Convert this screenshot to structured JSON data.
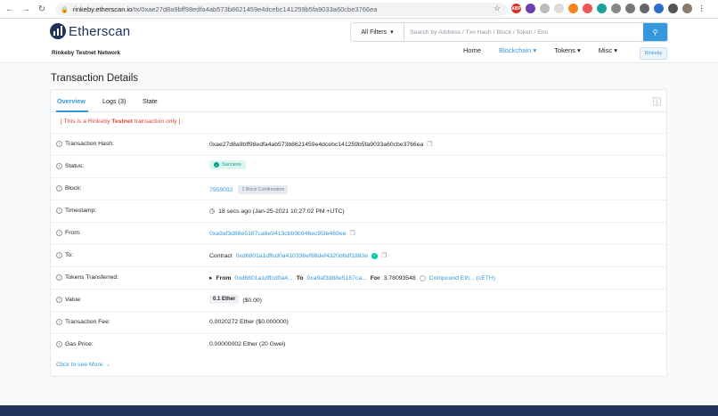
{
  "browser": {
    "url_host": "rinkeby.etherscan.io",
    "url_path": "/tx/0xae27d8a9bff98edfa4ab573b8621459e4dcebc141259b5fa9033a60cbe3766ea"
  },
  "header": {
    "logo_text": "Etherscan",
    "network_label": "Rinkeby Testnet Network",
    "search": {
      "filter_label": "All Filters",
      "placeholder": "Search by Address / Txn Hash / Block / Token / Ens"
    },
    "nav": [
      {
        "label": "Home"
      },
      {
        "label": "Blockchain"
      },
      {
        "label": "Tokens"
      },
      {
        "label": "Misc"
      }
    ],
    "network_badge": "Rinkeby"
  },
  "page_title": "Transaction Details",
  "tabs": [
    {
      "label": "Overview"
    },
    {
      "label": "Logs (3)"
    },
    {
      "label": "State"
    }
  ],
  "notice": {
    "prefix": "[ This is a Rinkeby ",
    "bold": "Testnet",
    "suffix": " transaction only ]"
  },
  "fields": {
    "hash": {
      "label": "Transaction Hash:",
      "value": "0xae27d8a9bff98edfa4ab573b8621459e4dcebc141259b5fa9033a60cbe3766ea"
    },
    "status": {
      "label": "Status:",
      "value": "Success"
    },
    "block": {
      "label": "Block:",
      "value": "7959032",
      "confirmation": "1 Block Confirmation"
    },
    "timestamp": {
      "label": "Timestamp:",
      "value": "18 secs ago (Jan-25-2021 10:27:02 PM +UTC)"
    },
    "from": {
      "label": "From:",
      "value": "0xa9af3d88e5167ca6e9413cbb9b946ec95fe469ee"
    },
    "to": {
      "label": "To:",
      "prefix": "Contract",
      "value": "0xd6801a1dffcd0a410336ef88def4320d6df1883e"
    },
    "tokens": {
      "label": "Tokens Transferred:",
      "from_label": "From",
      "from_value": "0xd6801a1dffcd0a4...",
      "to_label": "To",
      "to_value": "0xa9af3d88e5167ca...",
      "for_label": "For",
      "amount": "3.78093548",
      "token": "Compound Eth... (cETH)"
    },
    "value": {
      "label": "Value:",
      "value": "0.1 Ether",
      "usd": "($0.00)"
    },
    "fee": {
      "label": "Transaction Fee:",
      "value": "0.0020272 Ether ($0.000000)"
    },
    "gas": {
      "label": "Gas Price:",
      "value": "0.00000002 Ether (20 Gwei)"
    }
  },
  "see_more": "Click to see More"
}
